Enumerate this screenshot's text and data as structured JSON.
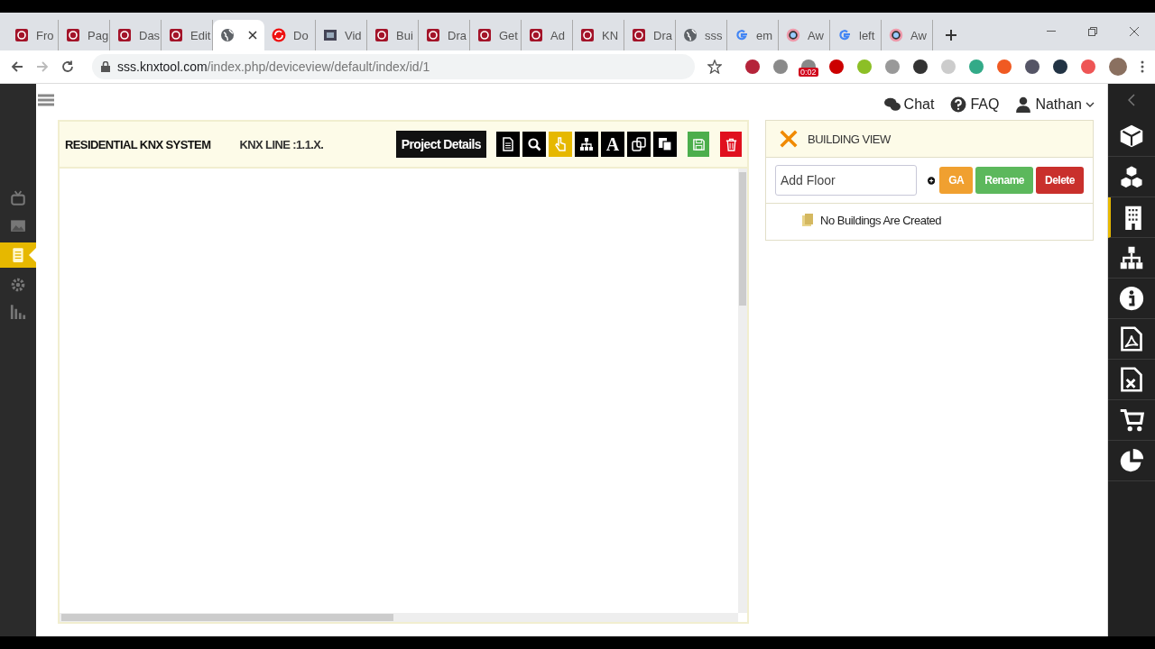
{
  "browser": {
    "tabs": [
      {
        "kind": "app",
        "title": "Fro",
        "selected": false
      },
      {
        "kind": "app",
        "title": "Pag",
        "selected": false
      },
      {
        "kind": "app",
        "title": "Das",
        "selected": false
      },
      {
        "kind": "app",
        "title": "Edit",
        "selected": false
      },
      {
        "kind": "globe",
        "selected": true
      },
      {
        "kind": "sync",
        "title": "Do",
        "selected": false
      },
      {
        "kind": "video",
        "title": "Vid",
        "selected": false
      },
      {
        "kind": "app",
        "title": "Bui",
        "selected": false
      },
      {
        "kind": "app",
        "title": "Dra",
        "selected": false
      },
      {
        "kind": "app",
        "title": "Get",
        "selected": false
      },
      {
        "kind": "app",
        "title": "Ad",
        "selected": false
      },
      {
        "kind": "app",
        "title": "KN",
        "selected": false
      },
      {
        "kind": "app",
        "title": "Dra",
        "selected": false
      },
      {
        "kind": "globe",
        "title": "sss",
        "selected": false
      },
      {
        "kind": "google",
        "title": "em",
        "selected": false
      },
      {
        "kind": "ring",
        "title": "Aw",
        "selected": false
      },
      {
        "kind": "google",
        "title": "left",
        "selected": false
      },
      {
        "kind": "ring",
        "title": "Aw",
        "selected": false
      }
    ],
    "address": {
      "domain": "sss.knxtool.com",
      "path": "/index.php/deviceview/default/index/id/1"
    },
    "extension_badge": "0:02"
  },
  "header": {
    "links": [
      {
        "kind": "chat",
        "label": "Chat"
      },
      {
        "kind": "question",
        "label": "FAQ"
      },
      {
        "kind": "user",
        "label": "Nathan"
      }
    ]
  },
  "left_nav": [
    {
      "kind": "tv",
      "selected": false
    },
    {
      "kind": "image",
      "selected": false
    },
    {
      "kind": "list",
      "selected": true
    },
    {
      "kind": "gear",
      "selected": false
    },
    {
      "kind": "bars",
      "selected": false
    }
  ],
  "project": {
    "title": "RESIDENTIAL KNX SYSTEM",
    "line": "KNX LINE :1.1.X.",
    "details_button": "Project Details",
    "tools": [
      {
        "kind": "document",
        "selected": false
      },
      {
        "kind": "search",
        "selected": false
      },
      {
        "kind": "hand",
        "selected": true
      },
      {
        "kind": "sitemap",
        "selected": false
      },
      {
        "kind": "letter",
        "label": "A",
        "selected": false
      },
      {
        "kind": "copy",
        "selected": false
      },
      {
        "kind": "paste",
        "selected": false
      }
    ],
    "actions": [
      {
        "kind": "save",
        "color": "#4cae4c"
      },
      {
        "kind": "trash",
        "color": "#e0101e"
      }
    ]
  },
  "building_view": {
    "title": "BUILDING VIEW",
    "placeholder": "Add Floor",
    "buttons": [
      {
        "label": "GA",
        "color": "#f0a030"
      },
      {
        "label": "Rename",
        "color": "#5cb85c"
      },
      {
        "label": "Delete",
        "color": "#c9302c"
      }
    ],
    "empty_message": "No Buildings Are Created"
  },
  "right_nav": [
    {
      "kind": "cube",
      "selected": false
    },
    {
      "kind": "cubes",
      "selected": false
    },
    {
      "kind": "building",
      "selected": true
    },
    {
      "kind": "sitemap",
      "selected": false
    },
    {
      "kind": "info",
      "selected": false
    },
    {
      "kind": "pdf",
      "selected": false
    },
    {
      "kind": "excel",
      "selected": false
    },
    {
      "kind": "cart",
      "selected": false
    },
    {
      "kind": "pie",
      "selected": false
    }
  ]
}
